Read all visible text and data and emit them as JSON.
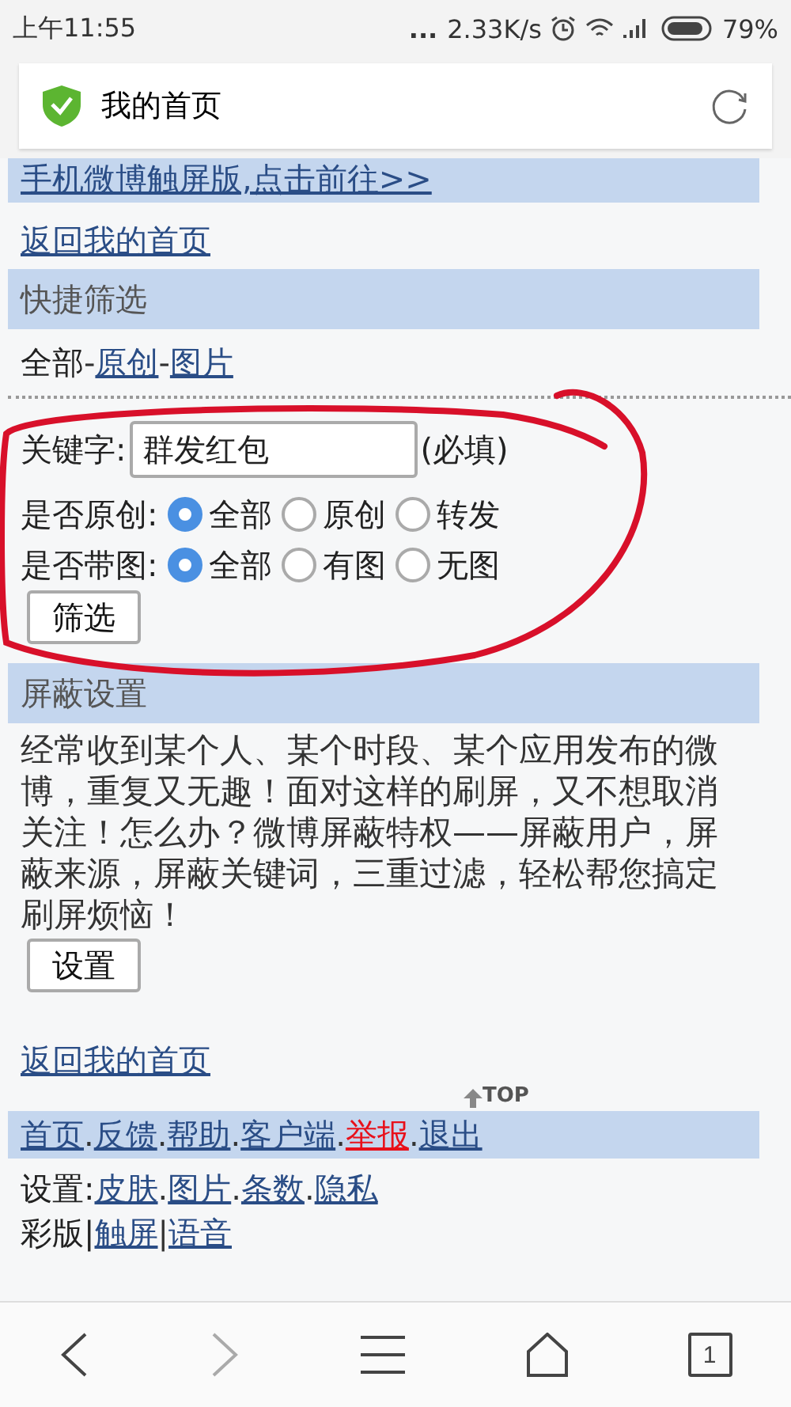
{
  "status_bar": {
    "time": "上午11:55",
    "dots": "...",
    "speed": "2.33K/s",
    "battery": "79%"
  },
  "address_bar": {
    "title": "我的首页"
  },
  "banner_link": "手机微博触屏版,点击前往>>",
  "back_link_top": "返回我的首页",
  "quick_filter": {
    "title": "快捷筛选",
    "current": "全部",
    "separator": "-",
    "links": [
      "原创",
      "图片"
    ]
  },
  "filter_form": {
    "keyword_label": "关键字:",
    "keyword_value": "群发红包",
    "required_note": "(必填)",
    "groups": [
      {
        "label": "是否原创:",
        "options": [
          {
            "label": "全部",
            "selected": true
          },
          {
            "label": "原创",
            "selected": false
          },
          {
            "label": "转发",
            "selected": false
          }
        ]
      },
      {
        "label": "是否带图:",
        "options": [
          {
            "label": "全部",
            "selected": true
          },
          {
            "label": "有图",
            "selected": false
          },
          {
            "label": "无图",
            "selected": false
          }
        ]
      }
    ],
    "submit": "筛选"
  },
  "block_settings": {
    "title": "屏蔽设置",
    "description": "经常收到某个人、某个时段、某个应用发布的微博，重复又无趣！面对这样的刷屏，又不想取消关注！怎么办？微博屏蔽特权——屏蔽用户，屏蔽来源，屏蔽关键词，三重过滤，轻松帮您搞定刷屏烦恼！",
    "button": "设置"
  },
  "back_link_bottom": "返回我的首页",
  "top_link": "TOP",
  "footer_nav": {
    "separator": ".",
    "links": [
      {
        "text": "首页",
        "color": "#2a4d86"
      },
      {
        "text": "反馈",
        "color": "#2a4d86"
      },
      {
        "text": "帮助",
        "color": "#2a4d86"
      },
      {
        "text": "客户端",
        "color": "#2a4d86"
      },
      {
        "text": "举报",
        "color": "#e8101a"
      },
      {
        "text": "退出",
        "color": "#2a4d86"
      }
    ]
  },
  "settings_line": {
    "label": "设置:",
    "separator": ".",
    "links": [
      "皮肤",
      "图片",
      "条数",
      "隐私"
    ]
  },
  "version_line": {
    "label": "彩版|",
    "separator": "|",
    "links": [
      "触屏",
      "语音"
    ]
  },
  "browser_nav": [
    {
      "kind": "back",
      "disabled": false
    },
    {
      "kind": "forward",
      "disabled": true
    },
    {
      "kind": "menu",
      "disabled": false
    },
    {
      "kind": "home",
      "disabled": false
    },
    {
      "kind": "tabs",
      "disabled": false,
      "count": "1"
    }
  ]
}
